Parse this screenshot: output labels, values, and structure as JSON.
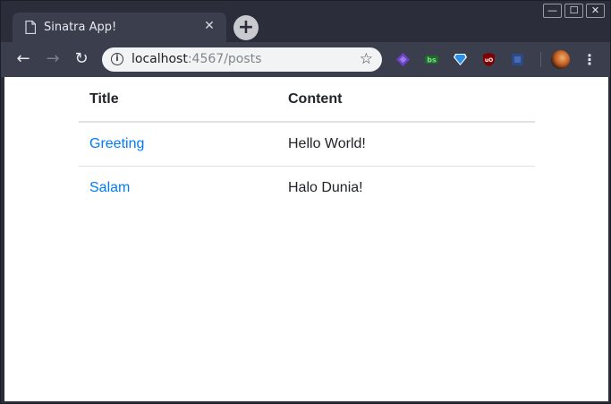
{
  "browser": {
    "tab": {
      "title": "Sinatra App!",
      "close_glyph": "✕"
    },
    "new_tab_glyph": "+",
    "window_controls": {
      "minimize": "—",
      "maximize": "☐",
      "close": "✕"
    },
    "nav": {
      "back": "←",
      "forward": "→",
      "reload": "↻"
    },
    "address": {
      "host": "localhost",
      "rest": ":4567/posts"
    },
    "menu_glyph": "⋮",
    "extensions": [
      "gem-extension-icon",
      "b-extension-icon",
      "diamond-extension-icon",
      "ublock-origin-icon",
      "gray-extension-icon"
    ]
  },
  "page": {
    "table": {
      "headers": {
        "title": "Title",
        "content": "Content"
      },
      "rows": [
        {
          "title": "Greeting",
          "content": "Hello World!"
        },
        {
          "title": "Salam",
          "content": "Halo Dunia!"
        }
      ]
    }
  },
  "colors": {
    "link": "#007bff",
    "chrome_dark": "#2b2e3a",
    "chrome_toolbar": "#3a3e4d"
  }
}
